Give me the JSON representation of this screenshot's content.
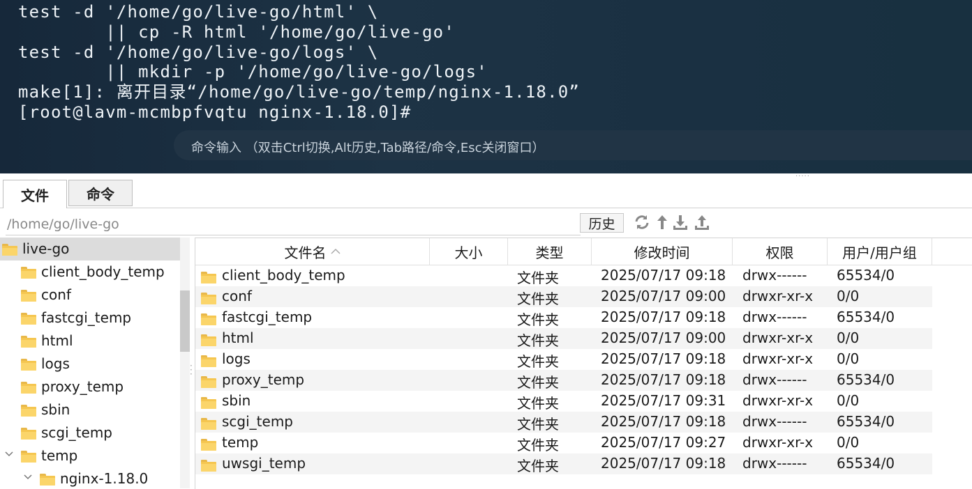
{
  "terminal": {
    "lines": [
      "test -d '/home/go/live-go/html' \\",
      "        || cp -R html '/home/go/live-go'",
      "test -d '/home/go/live-go/logs' \\",
      "        || mkdir -p '/home/go/live-go/logs'",
      "make[1]: 离开目录“/home/go/live-go/temp/nginx-1.18.0”",
      "[root@lavm-mcmbpfvqtu nginx-1.18.0]#"
    ],
    "input_hint": "命令输入 （双击Ctrl切换,Alt历史,Tab路径/命令,Esc关闭窗口）"
  },
  "tabs": {
    "files": "文件",
    "commands": "命令"
  },
  "pathbar": {
    "path": "/home/go/live-go",
    "history_label": "历史",
    "icons": [
      "refresh-icon",
      "up-arrow-icon",
      "download-icon",
      "upload-icon"
    ]
  },
  "tree": {
    "root": "live-go",
    "children": [
      "client_body_temp",
      "conf",
      "fastcgi_temp",
      "html",
      "logs",
      "proxy_temp",
      "sbin",
      "scgi_temp",
      "temp"
    ],
    "temp_child": "nginx-1.18.0"
  },
  "columns": {
    "name": "文件名",
    "size": "大小",
    "type": "类型",
    "mtime": "修改时间",
    "perm": "权限",
    "owner": "用户/用户组"
  },
  "files": [
    {
      "name": "client_body_temp",
      "type": "文件夹",
      "mtime": "2025/07/17 09:18",
      "perm": "drwx------",
      "owner": "65534/0"
    },
    {
      "name": "conf",
      "type": "文件夹",
      "mtime": "2025/07/17 09:00",
      "perm": "drwxr-xr-x",
      "owner": "0/0"
    },
    {
      "name": "fastcgi_temp",
      "type": "文件夹",
      "mtime": "2025/07/17 09:18",
      "perm": "drwx------",
      "owner": "65534/0"
    },
    {
      "name": "html",
      "type": "文件夹",
      "mtime": "2025/07/17 09:00",
      "perm": "drwxr-xr-x",
      "owner": "0/0"
    },
    {
      "name": "logs",
      "type": "文件夹",
      "mtime": "2025/07/17 09:18",
      "perm": "drwxr-xr-x",
      "owner": "0/0"
    },
    {
      "name": "proxy_temp",
      "type": "文件夹",
      "mtime": "2025/07/17 09:18",
      "perm": "drwx------",
      "owner": "65534/0"
    },
    {
      "name": "sbin",
      "type": "文件夹",
      "mtime": "2025/07/17 09:31",
      "perm": "drwxr-xr-x",
      "owner": "0/0"
    },
    {
      "name": "scgi_temp",
      "type": "文件夹",
      "mtime": "2025/07/17 09:18",
      "perm": "drwx------",
      "owner": "65534/0"
    },
    {
      "name": "temp",
      "type": "文件夹",
      "mtime": "2025/07/17 09:27",
      "perm": "drwxr-xr-x",
      "owner": "0/0"
    },
    {
      "name": "uwsgi_temp",
      "type": "文件夹",
      "mtime": "2025/07/17 09:18",
      "perm": "drwx------",
      "owner": "65534/0"
    }
  ],
  "colors": {
    "terminal_bg": "#1d3345",
    "folder": "#f5c650",
    "selected": "#dcdcdc"
  }
}
